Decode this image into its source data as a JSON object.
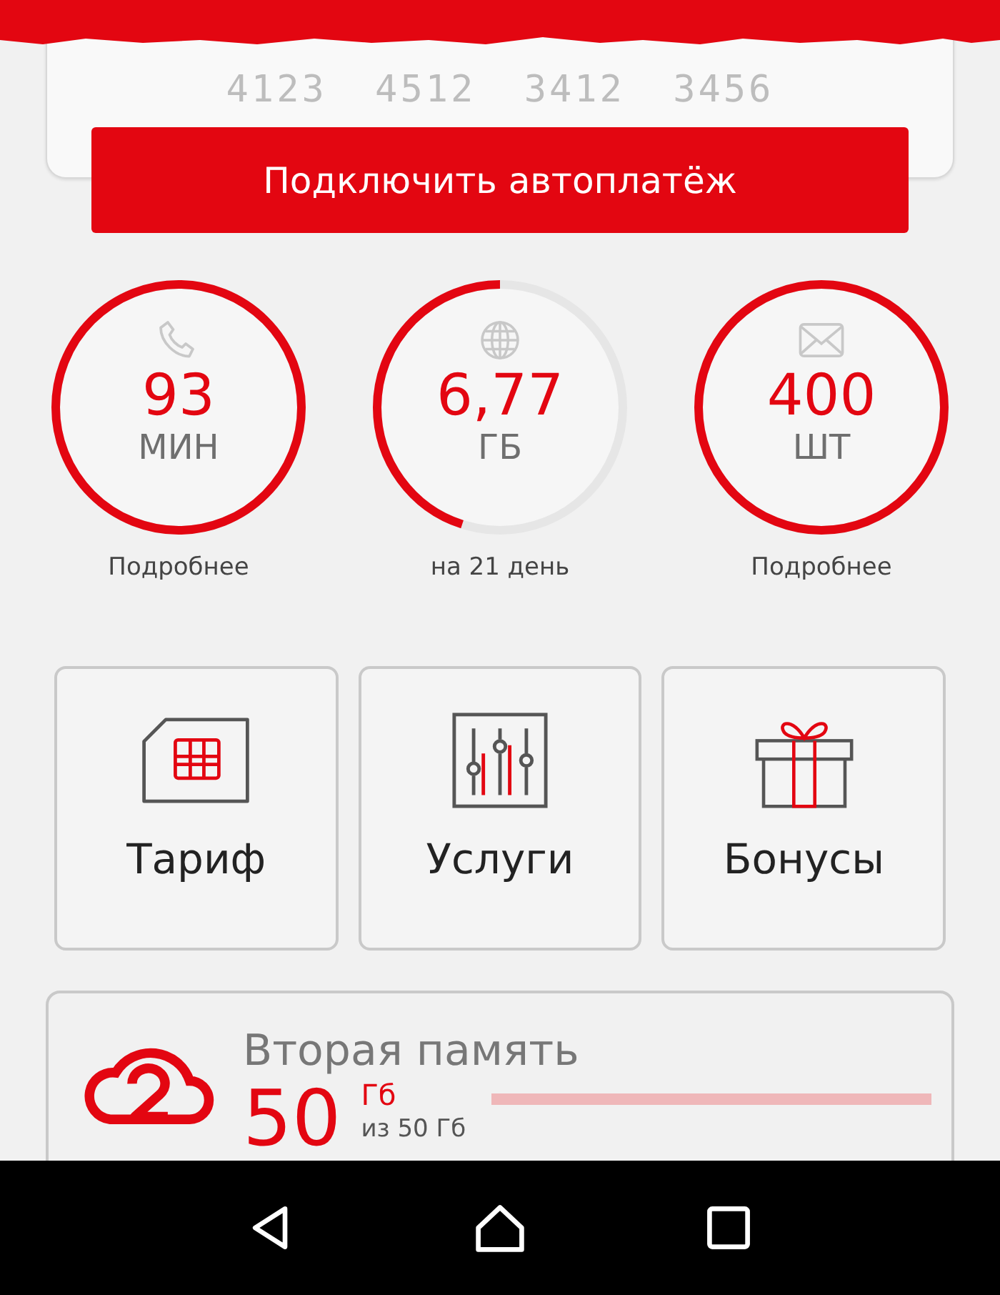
{
  "card": {
    "number": "4123 4512 3412 3456"
  },
  "autopay_button": {
    "label": "Подключить автоплатёж"
  },
  "counters": [
    {
      "kind": "calls",
      "value": "93",
      "unit": "МИН",
      "caption": "Подробнее",
      "level": 1
    },
    {
      "kind": "internet",
      "value": "6,77",
      "unit": "ГБ",
      "caption": "на 21 день",
      "level": 0.45
    },
    {
      "kind": "sms",
      "value": "400",
      "unit": "ШТ",
      "caption": "Подробнее",
      "level": 1
    }
  ],
  "tiles": [
    {
      "kind": "sim",
      "label": "Тариф"
    },
    {
      "kind": "services",
      "label": "Услуги"
    },
    {
      "kind": "gift",
      "label": "Бонусы"
    }
  ],
  "storage": {
    "title": "Вторая память",
    "value": "50",
    "unit": "Гб",
    "total": "из 50 Гб",
    "level": 1
  }
}
